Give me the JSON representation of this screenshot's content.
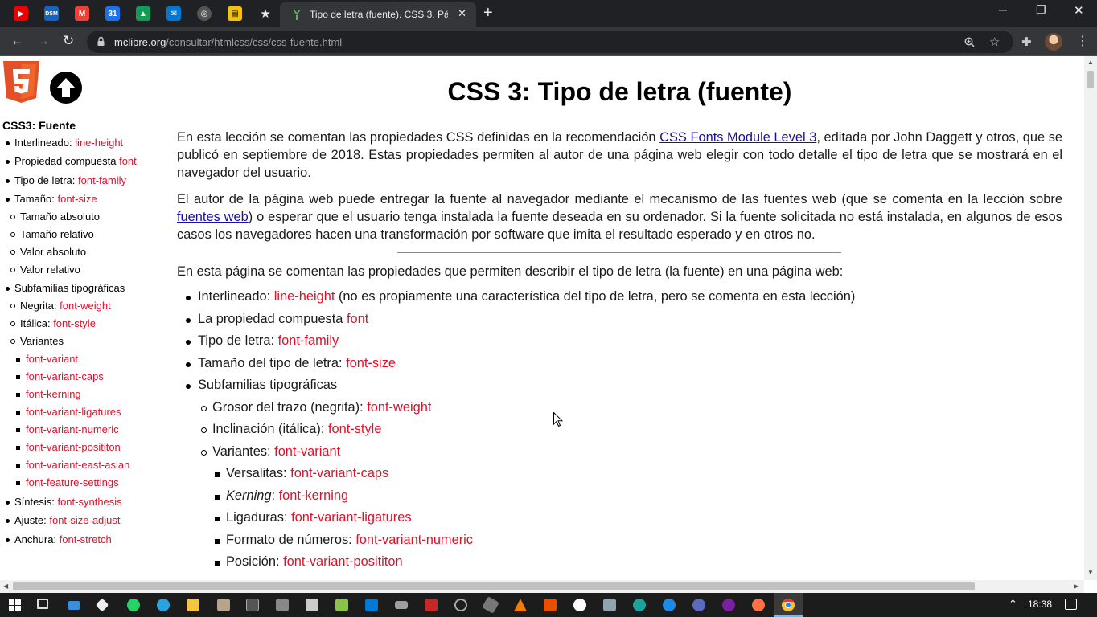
{
  "browser": {
    "tab_title": "Tipo de letra (fuente). CSS 3. Pág",
    "url_host": "mclibre.org",
    "url_path": "/consultar/htmlcss/css/css-fuente.html"
  },
  "sidebar": {
    "title": "CSS3: Fuente",
    "items": [
      {
        "label": "Interlineado: ",
        "code": "line-height"
      },
      {
        "label": "Propiedad compuesta ",
        "code": "font"
      },
      {
        "label": "Tipo de letra: ",
        "code": "font-family"
      },
      {
        "label": "Tamaño: ",
        "code": "font-size"
      },
      {
        "label": "Tamaño absoluto",
        "code": ""
      },
      {
        "label": "Tamaño relativo",
        "code": ""
      },
      {
        "label": "Valor absoluto",
        "code": ""
      },
      {
        "label": "Valor relativo",
        "code": ""
      },
      {
        "label": "Subfamilias tipográficas",
        "code": ""
      },
      {
        "label": "Negrita: ",
        "code": "font-weight"
      },
      {
        "label": "Itálica: ",
        "code": "font-style"
      },
      {
        "label": "Variantes",
        "code": ""
      },
      {
        "label": "",
        "code": "font-variant"
      },
      {
        "label": "",
        "code": "font-variant-caps"
      },
      {
        "label": "",
        "code": "font-kerning"
      },
      {
        "label": "",
        "code": "font-variant-ligatures"
      },
      {
        "label": "",
        "code": "font-variant-numeric"
      },
      {
        "label": "",
        "code": "font-variant-posititon"
      },
      {
        "label": "",
        "code": "font-variant-east-asian"
      },
      {
        "label": "",
        "code": "font-feature-settings"
      },
      {
        "label": "Síntesis: ",
        "code": "font-synthesis"
      },
      {
        "label": "Ajuste: ",
        "code": "font-size-adjust"
      },
      {
        "label": "Anchura: ",
        "code": "font-stretch"
      }
    ]
  },
  "main": {
    "title": "CSS 3: Tipo de letra (fuente)",
    "p1_a": "En esta lección se comentan las propiedades CSS definidas en la recomendación ",
    "p1_link": "CSS Fonts Module Level 3",
    "p1_b": ", editada por John Daggett y otros, que se publicó en septiembre de 2018. Estas propiedades permiten al autor de una página web elegir con todo detalle el tipo de letra que se mostrará en el navegador del usuario.",
    "p2_a": "El autor de la página web puede entregar la fuente al navegador mediante el mecanismo de las fuentes web (que se comenta en la lección sobre ",
    "p2_link": "fuentes web",
    "p2_b": ") o esperar que el usuario tenga instalada la fuente deseada en su ordenador. Si la fuente solicitada no está instalada, en algunos de esos casos los navegadores hacen una transformación por software que imita el resultado esperado y en otros no.",
    "p3": "En esta página se comentan las propiedades que permiten describir el tipo de letra (la fuente) en una página web:",
    "list": [
      {
        "label": "Interlineado: ",
        "code": "line-height",
        "after": " (no es propiamente una característica del tipo de letra, pero se comenta en esta lección)"
      },
      {
        "label": "La propiedad compuesta ",
        "code": "font",
        "after": ""
      },
      {
        "label": "Tipo de letra: ",
        "code": "font-family",
        "after": ""
      },
      {
        "label": "Tamaño del tipo de letra: ",
        "code": "font-size",
        "after": ""
      },
      {
        "label": "Subfamilias tipográficas",
        "code": "",
        "after": ""
      },
      {
        "label": "Grosor del trazo (negrita): ",
        "code": "font-weight",
        "after": ""
      },
      {
        "label": "Inclinación (itálica): ",
        "code": "font-style",
        "after": ""
      },
      {
        "label": "Variantes: ",
        "code": "font-variant",
        "after": ""
      },
      {
        "label": "Versalitas: ",
        "code": "font-variant-caps",
        "after": ""
      },
      {
        "label": "Kerning",
        "code": "font-kerning",
        "after": ""
      },
      {
        "label": "Ligaduras: ",
        "code": "font-variant-ligatures",
        "after": ""
      },
      {
        "label": "Formato de números: ",
        "code": "font-variant-numeric",
        "after": ""
      },
      {
        "label": "Posición: ",
        "code": "font-variant-posititon",
        "after": ""
      }
    ],
    "kerning_sep": ": "
  },
  "taskbar": {
    "clock": "18:38"
  }
}
